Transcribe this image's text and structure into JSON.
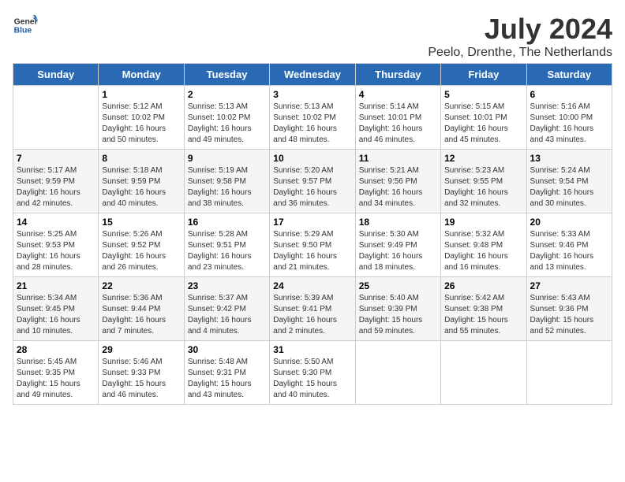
{
  "header": {
    "logo_line1": "General",
    "logo_line2": "Blue",
    "month_year": "July 2024",
    "location": "Peelo, Drenthe, The Netherlands"
  },
  "weekdays": [
    "Sunday",
    "Monday",
    "Tuesday",
    "Wednesday",
    "Thursday",
    "Friday",
    "Saturday"
  ],
  "weeks": [
    [
      {
        "day": "",
        "info": ""
      },
      {
        "day": "1",
        "info": "Sunrise: 5:12 AM\nSunset: 10:02 PM\nDaylight: 16 hours\nand 50 minutes."
      },
      {
        "day": "2",
        "info": "Sunrise: 5:13 AM\nSunset: 10:02 PM\nDaylight: 16 hours\nand 49 minutes."
      },
      {
        "day": "3",
        "info": "Sunrise: 5:13 AM\nSunset: 10:02 PM\nDaylight: 16 hours\nand 48 minutes."
      },
      {
        "day": "4",
        "info": "Sunrise: 5:14 AM\nSunset: 10:01 PM\nDaylight: 16 hours\nand 46 minutes."
      },
      {
        "day": "5",
        "info": "Sunrise: 5:15 AM\nSunset: 10:01 PM\nDaylight: 16 hours\nand 45 minutes."
      },
      {
        "day": "6",
        "info": "Sunrise: 5:16 AM\nSunset: 10:00 PM\nDaylight: 16 hours\nand 43 minutes."
      }
    ],
    [
      {
        "day": "7",
        "info": "Sunrise: 5:17 AM\nSunset: 9:59 PM\nDaylight: 16 hours\nand 42 minutes."
      },
      {
        "day": "8",
        "info": "Sunrise: 5:18 AM\nSunset: 9:59 PM\nDaylight: 16 hours\nand 40 minutes."
      },
      {
        "day": "9",
        "info": "Sunrise: 5:19 AM\nSunset: 9:58 PM\nDaylight: 16 hours\nand 38 minutes."
      },
      {
        "day": "10",
        "info": "Sunrise: 5:20 AM\nSunset: 9:57 PM\nDaylight: 16 hours\nand 36 minutes."
      },
      {
        "day": "11",
        "info": "Sunrise: 5:21 AM\nSunset: 9:56 PM\nDaylight: 16 hours\nand 34 minutes."
      },
      {
        "day": "12",
        "info": "Sunrise: 5:23 AM\nSunset: 9:55 PM\nDaylight: 16 hours\nand 32 minutes."
      },
      {
        "day": "13",
        "info": "Sunrise: 5:24 AM\nSunset: 9:54 PM\nDaylight: 16 hours\nand 30 minutes."
      }
    ],
    [
      {
        "day": "14",
        "info": "Sunrise: 5:25 AM\nSunset: 9:53 PM\nDaylight: 16 hours\nand 28 minutes."
      },
      {
        "day": "15",
        "info": "Sunrise: 5:26 AM\nSunset: 9:52 PM\nDaylight: 16 hours\nand 26 minutes."
      },
      {
        "day": "16",
        "info": "Sunrise: 5:28 AM\nSunset: 9:51 PM\nDaylight: 16 hours\nand 23 minutes."
      },
      {
        "day": "17",
        "info": "Sunrise: 5:29 AM\nSunset: 9:50 PM\nDaylight: 16 hours\nand 21 minutes."
      },
      {
        "day": "18",
        "info": "Sunrise: 5:30 AM\nSunset: 9:49 PM\nDaylight: 16 hours\nand 18 minutes."
      },
      {
        "day": "19",
        "info": "Sunrise: 5:32 AM\nSunset: 9:48 PM\nDaylight: 16 hours\nand 16 minutes."
      },
      {
        "day": "20",
        "info": "Sunrise: 5:33 AM\nSunset: 9:46 PM\nDaylight: 16 hours\nand 13 minutes."
      }
    ],
    [
      {
        "day": "21",
        "info": "Sunrise: 5:34 AM\nSunset: 9:45 PM\nDaylight: 16 hours\nand 10 minutes."
      },
      {
        "day": "22",
        "info": "Sunrise: 5:36 AM\nSunset: 9:44 PM\nDaylight: 16 hours\nand 7 minutes."
      },
      {
        "day": "23",
        "info": "Sunrise: 5:37 AM\nSunset: 9:42 PM\nDaylight: 16 hours\nand 4 minutes."
      },
      {
        "day": "24",
        "info": "Sunrise: 5:39 AM\nSunset: 9:41 PM\nDaylight: 16 hours\nand 2 minutes."
      },
      {
        "day": "25",
        "info": "Sunrise: 5:40 AM\nSunset: 9:39 PM\nDaylight: 15 hours\nand 59 minutes."
      },
      {
        "day": "26",
        "info": "Sunrise: 5:42 AM\nSunset: 9:38 PM\nDaylight: 15 hours\nand 55 minutes."
      },
      {
        "day": "27",
        "info": "Sunrise: 5:43 AM\nSunset: 9:36 PM\nDaylight: 15 hours\nand 52 minutes."
      }
    ],
    [
      {
        "day": "28",
        "info": "Sunrise: 5:45 AM\nSunset: 9:35 PM\nDaylight: 15 hours\nand 49 minutes."
      },
      {
        "day": "29",
        "info": "Sunrise: 5:46 AM\nSunset: 9:33 PM\nDaylight: 15 hours\nand 46 minutes."
      },
      {
        "day": "30",
        "info": "Sunrise: 5:48 AM\nSunset: 9:31 PM\nDaylight: 15 hours\nand 43 minutes."
      },
      {
        "day": "31",
        "info": "Sunrise: 5:50 AM\nSunset: 9:30 PM\nDaylight: 15 hours\nand 40 minutes."
      },
      {
        "day": "",
        "info": ""
      },
      {
        "day": "",
        "info": ""
      },
      {
        "day": "",
        "info": ""
      }
    ]
  ]
}
